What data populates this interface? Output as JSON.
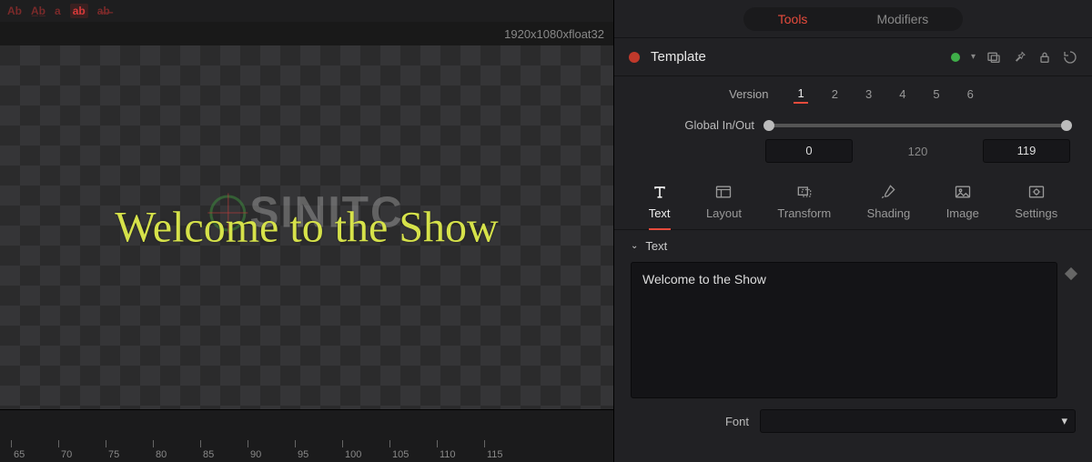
{
  "viewer": {
    "resolution": "1920x1080xfloat32",
    "canvas_text": "Welcome to the Show",
    "watermark": "SINITC"
  },
  "timeline": {
    "ticks": [
      "65",
      "70",
      "75",
      "80",
      "85",
      "90",
      "95",
      "100",
      "105",
      "110",
      "115"
    ]
  },
  "top_tabs": {
    "tools": "Tools",
    "modifiers": "Modifiers"
  },
  "node": {
    "name": "Template"
  },
  "versions": {
    "label": "Version",
    "numbers": [
      "1",
      "2",
      "3",
      "4",
      "5",
      "6"
    ]
  },
  "global_io": {
    "label": "Global In/Out",
    "in": "0",
    "mid": "120",
    "out": "119"
  },
  "inspector_tabs": {
    "text": "Text",
    "layout": "Layout",
    "transform": "Transform",
    "shading": "Shading",
    "image": "Image",
    "settings": "Settings"
  },
  "section": {
    "text_header": "Text",
    "text_value": "Welcome to the Show"
  },
  "font": {
    "label": "Font"
  }
}
